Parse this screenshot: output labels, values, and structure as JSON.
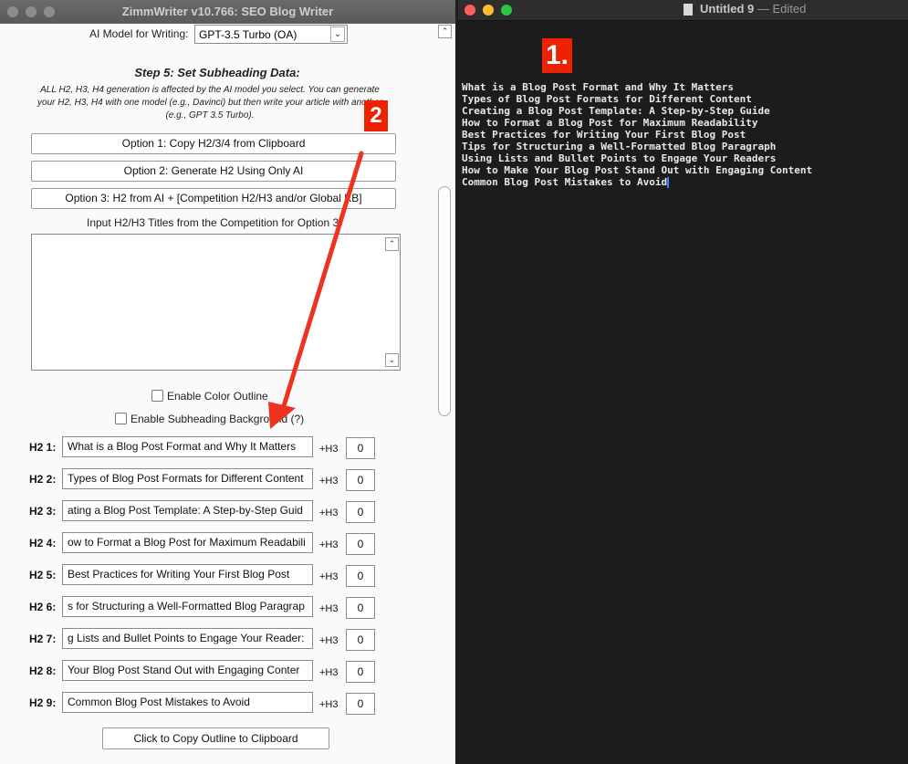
{
  "left_window": {
    "title": "ZimmWriter v10.766: SEO Blog Writer",
    "ai_model_label": "AI Model for Writing:",
    "ai_model_value": "GPT-3.5 Turbo (OA)",
    "step_heading": "Step 5: Set Subheading Data:",
    "description": "ALL H2, H3, H4 generation is affected by the AI model you select. You can generate your H2, H3, H4 with one model (e.g., Davinci) but then write your article with another (e.g., GPT 3.5 Turbo).",
    "option1": "Option 1: Copy H2/3/4 from Clipboard",
    "option2": "Option 2: Generate H2 Using Only AI",
    "option3": "Option 3: H2 from AI + [Competition H2/H3 and/or Global KB]",
    "competition_label": "Input H2/H3 Titles from the Competition for Option 3:",
    "competition_text": "",
    "enable_color_outline": "Enable Color Outline",
    "enable_subheading_bg": "Enable Subheading Background (?)",
    "h3_label": "+H3",
    "h2_rows": [
      {
        "label": "H2 1:",
        "value": "What is a Blog Post Format and Why It Matters",
        "h3": "0"
      },
      {
        "label": "H2 2:",
        "value": "Types of Blog Post Formats for Different Content",
        "h3": "0"
      },
      {
        "label": "H2 3:",
        "value": "ating a Blog Post Template: A Step-by-Step Guid",
        "h3": "0"
      },
      {
        "label": "H2 4:",
        "value": "ow to Format a Blog Post for Maximum Readabili",
        "h3": "0"
      },
      {
        "label": "H2 5:",
        "value": "Best Practices for Writing Your First Blog Post",
        "h3": "0"
      },
      {
        "label": "H2 6:",
        "value": "s for Structuring a Well-Formatted Blog Paragrap",
        "h3": "0"
      },
      {
        "label": "H2 7:",
        "value": "g Lists and Bullet Points to Engage Your Reader:",
        "h3": "0"
      },
      {
        "label": "H2 8:",
        "value": " Your Blog Post Stand Out with Engaging Conter",
        "h3": "0"
      },
      {
        "label": "H2 9:",
        "value": "Common Blog Post Mistakes to Avoid",
        "h3": "0"
      }
    ],
    "copy_outline_button": "Click to Copy Outline to Clipboard"
  },
  "right_window": {
    "title": "Untitled 9",
    "title_status": "— Edited",
    "lines": [
      "What is a Blog Post Format and Why It Matters",
      "Types of Blog Post Formats for Different Content",
      "Creating a Blog Post Template: A Step-by-Step Guide",
      "How to Format a Blog Post for Maximum Readability",
      "Best Practices for Writing Your First Blog Post",
      "Tips for Structuring a Well-Formatted Blog Paragraph",
      "Using Lists and Bullet Points to Engage Your Readers",
      "How to Make Your Blog Post Stand Out with Engaging Content",
      "Common Blog Post Mistakes to Avoid"
    ]
  },
  "annotations": {
    "badge1": "1.",
    "badge2": "2",
    "arrow_color": "#ee3322"
  },
  "colors": {
    "left_bg": "#fafafa",
    "editor_bg": "#1c1c1c",
    "caret": "#3a7bff"
  }
}
